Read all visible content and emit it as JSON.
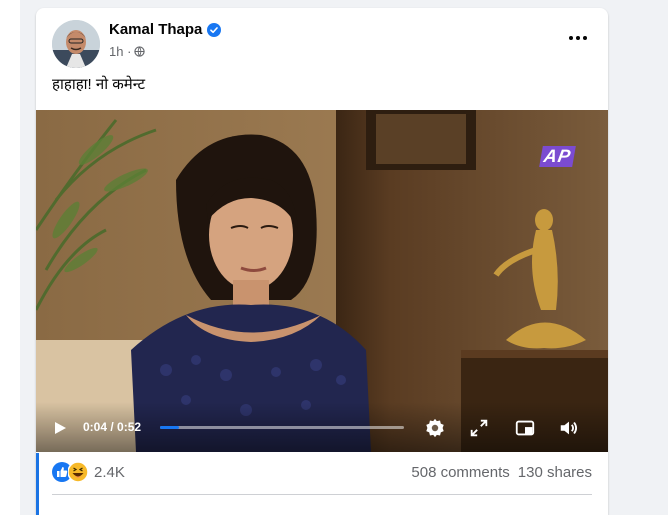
{
  "post": {
    "author": "Kamal Thapa",
    "time": "1h ·",
    "text": "हाहाहा! नो कमेन्ट"
  },
  "video": {
    "time_display": "0:04 / 0:52",
    "progress_fraction": 0.077,
    "channel_logo_text": "AP"
  },
  "stats": {
    "reactions_count": "2.4K",
    "comments": "508 comments",
    "shares": "130 shares"
  },
  "colors": {
    "accent": "#1877f2",
    "like": "#1877f2",
    "haha": "#f7b928"
  },
  "icons": [
    "verified-icon",
    "globe-icon",
    "more-options-icon",
    "play-icon",
    "settings-icon",
    "expand-icon",
    "picture-in-picture-icon",
    "volume-icon",
    "like-reaction-icon",
    "haha-reaction-icon"
  ]
}
